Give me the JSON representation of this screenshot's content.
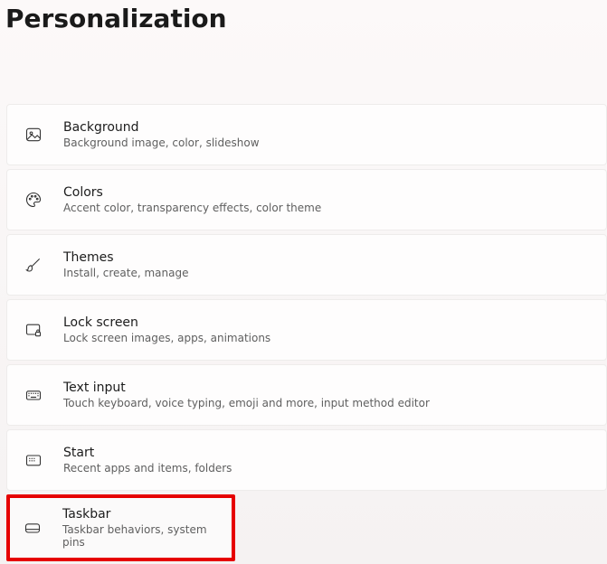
{
  "page": {
    "title": "Personalization"
  },
  "items": [
    {
      "title": "Background",
      "desc": "Background image, color, slideshow"
    },
    {
      "title": "Colors",
      "desc": "Accent color, transparency effects, color theme"
    },
    {
      "title": "Themes",
      "desc": "Install, create, manage"
    },
    {
      "title": "Lock screen",
      "desc": "Lock screen images, apps, animations"
    },
    {
      "title": "Text input",
      "desc": "Touch keyboard, voice typing, emoji and more, input method editor"
    },
    {
      "title": "Start",
      "desc": "Recent apps and items, folders"
    },
    {
      "title": "Taskbar",
      "desc": "Taskbar behaviors, system pins"
    }
  ]
}
